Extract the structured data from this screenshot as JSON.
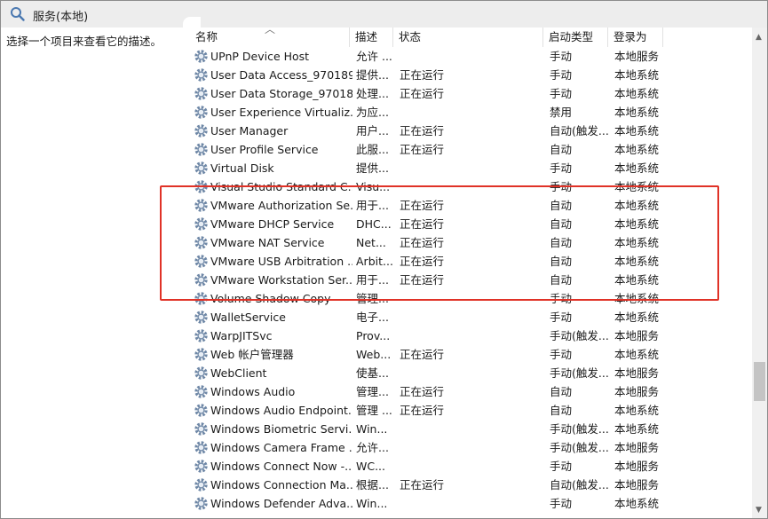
{
  "window": {
    "title": "服务(本地)"
  },
  "left_pane": {
    "description": "选择一个项目来查看它的描述。"
  },
  "columns": {
    "name": "名称",
    "description": "描述",
    "status": "状态",
    "startup": "启动类型",
    "logon": "登录为"
  },
  "services": [
    {
      "name": "UPnP Device Host",
      "desc": "允许 ...",
      "status": "",
      "startup": "手动",
      "logon": "本地服务"
    },
    {
      "name": "User Data Access_970189",
      "desc": "提供...",
      "status": "正在运行",
      "startup": "手动",
      "logon": "本地系统"
    },
    {
      "name": "User Data Storage_970189",
      "desc": "处理...",
      "status": "正在运行",
      "startup": "手动",
      "logon": "本地系统"
    },
    {
      "name": "User Experience Virtualiz...",
      "desc": "为应...",
      "status": "",
      "startup": "禁用",
      "logon": "本地系统"
    },
    {
      "name": "User Manager",
      "desc": "用户...",
      "status": "正在运行",
      "startup": "自动(触发...",
      "logon": "本地系统"
    },
    {
      "name": "User Profile Service",
      "desc": "此服...",
      "status": "正在运行",
      "startup": "自动",
      "logon": "本地系统"
    },
    {
      "name": "Virtual Disk",
      "desc": "提供...",
      "status": "",
      "startup": "手动",
      "logon": "本地系统"
    },
    {
      "name": "Visual Studio Standard C...",
      "desc": "Visu...",
      "status": "",
      "startup": "手动",
      "logon": "本地系统"
    },
    {
      "name": "VMware Authorization Se...",
      "desc": "用于...",
      "status": "正在运行",
      "startup": "自动",
      "logon": "本地系统"
    },
    {
      "name": "VMware DHCP Service",
      "desc": "DHC...",
      "status": "正在运行",
      "startup": "自动",
      "logon": "本地系统"
    },
    {
      "name": "VMware NAT Service",
      "desc": "Net...",
      "status": "正在运行",
      "startup": "自动",
      "logon": "本地系统"
    },
    {
      "name": "VMware USB Arbitration ...",
      "desc": "Arbit...",
      "status": "正在运行",
      "startup": "自动",
      "logon": "本地系统"
    },
    {
      "name": "VMware Workstation Ser...",
      "desc": "用于...",
      "status": "正在运行",
      "startup": "自动",
      "logon": "本地系统"
    },
    {
      "name": "Volume Shadow Copy",
      "desc": "管理...",
      "status": "",
      "startup": "手动",
      "logon": "本地系统"
    },
    {
      "name": "WalletService",
      "desc": "电子...",
      "status": "",
      "startup": "手动",
      "logon": "本地系统"
    },
    {
      "name": "WarpJITSvc",
      "desc": "Prov...",
      "status": "",
      "startup": "手动(触发...",
      "logon": "本地服务"
    },
    {
      "name": "Web 帐户管理器",
      "desc": "Web...",
      "status": "正在运行",
      "startup": "手动",
      "logon": "本地系统"
    },
    {
      "name": "WebClient",
      "desc": "使基...",
      "status": "",
      "startup": "手动(触发...",
      "logon": "本地服务"
    },
    {
      "name": "Windows Audio",
      "desc": "管理...",
      "status": "正在运行",
      "startup": "自动",
      "logon": "本地服务"
    },
    {
      "name": "Windows Audio Endpoint...",
      "desc": "管理 ...",
      "status": "正在运行",
      "startup": "自动",
      "logon": "本地系统"
    },
    {
      "name": "Windows Biometric Servi...",
      "desc": "Win...",
      "status": "",
      "startup": "手动(触发...",
      "logon": "本地系统"
    },
    {
      "name": "Windows Camera Frame ...",
      "desc": "允许...",
      "status": "",
      "startup": "手动(触发...",
      "logon": "本地服务"
    },
    {
      "name": "Windows Connect Now -...",
      "desc": "WC...",
      "status": "",
      "startup": "手动",
      "logon": "本地服务"
    },
    {
      "name": "Windows Connection Ma...",
      "desc": "根据...",
      "status": "正在运行",
      "startup": "自动(触发...",
      "logon": "本地服务"
    },
    {
      "name": "Windows Defender Adva...",
      "desc": "Win...",
      "status": "",
      "startup": "手动",
      "logon": "本地系统"
    },
    {
      "name": "",
      "desc": "",
      "status": "",
      "startup": "",
      "logon": ""
    }
  ],
  "colors": {
    "highlight": "#e03227",
    "titlebar": "#ededed",
    "icon_gear": "#6e87a6"
  }
}
